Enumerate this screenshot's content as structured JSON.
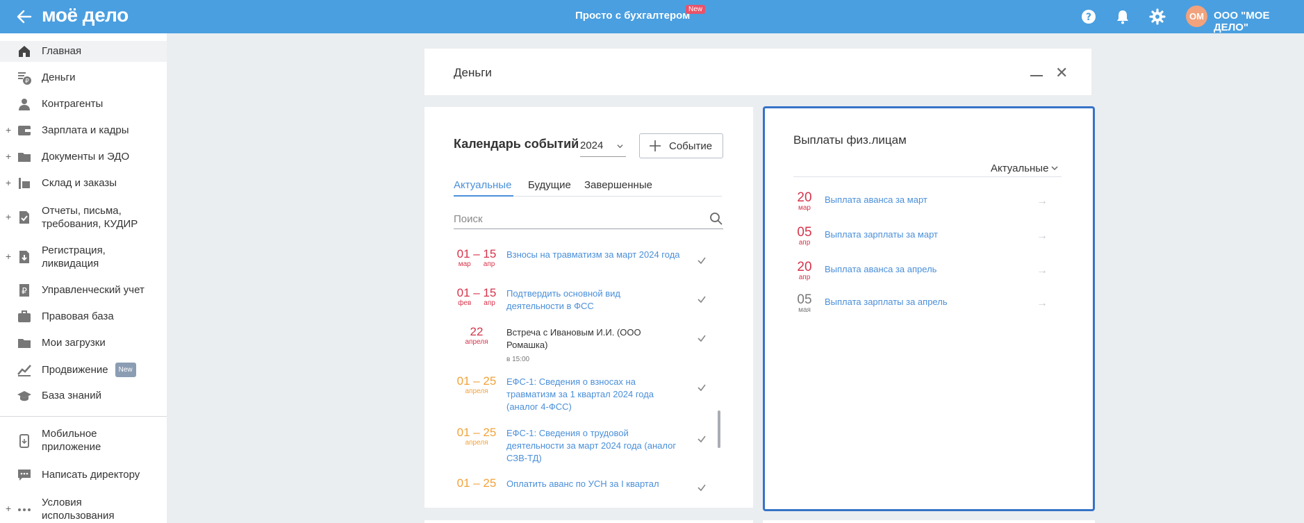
{
  "header": {
    "logo": "моё дело",
    "center_title": "Просто с бухгалтером",
    "center_badge": "New",
    "avatar_initials": "ОМ",
    "company": "ООО \"МОЕ ДЕЛО\""
  },
  "sidebar": {
    "items": [
      {
        "label": "Главная"
      },
      {
        "label": "Деньги"
      },
      {
        "label": "Контрагенты"
      },
      {
        "label": "Зарплата и кадры"
      },
      {
        "label": "Документы и ЭДО"
      },
      {
        "label": "Склад и заказы"
      },
      {
        "label": "Отчеты, письма, требования, КУДИР"
      },
      {
        "label": "Регистрация, ликвидация"
      },
      {
        "label": "Управленческий учет"
      },
      {
        "label": "Правовая база"
      },
      {
        "label": "Мои загрузки"
      },
      {
        "label": "Продвижение",
        "badge": "New"
      },
      {
        "label": "База знаний"
      }
    ],
    "bottom_items": [
      {
        "label": "Мобильное приложение"
      },
      {
        "label": "Написать директору"
      },
      {
        "label": "Условия использования"
      }
    ]
  },
  "money": {
    "title": "Деньги"
  },
  "calendar": {
    "title": "Календарь событий",
    "year": "2024",
    "add_event": "Событие",
    "tabs": [
      "Актуальные",
      "Будущие",
      "Завершенные"
    ],
    "search_placeholder": "Поиск",
    "events": [
      {
        "range": "01 – 15",
        "m1": "мар",
        "m2": "апр",
        "title": "Взносы на травматизм за март 2024 года",
        "sub": "",
        "color": "red"
      },
      {
        "range": "01 – 15",
        "m1": "фев",
        "m2": "апр",
        "title": "Подтвердить основной вид деятельности в ФСС",
        "sub": "",
        "color": "red"
      },
      {
        "range": "22",
        "m1": "апреля",
        "m2": "",
        "title": "Встреча с Ивановым И.И. (ООО Ромашка)",
        "sub": "в 15:00",
        "color": "red"
      },
      {
        "range": "01 – 25",
        "m1": "апреля",
        "m2": "",
        "title": "ЕФС-1: Сведения о взносах на травматизм за 1 квартал 2024 года (аналог 4-ФСС)",
        "sub": "",
        "color": "orange"
      },
      {
        "range": "01 – 25",
        "m1": "апреля",
        "m2": "",
        "title": "ЕФС-1: Сведения о трудовой деятельности за март 2024 года (аналог СЗВ-ТД)",
        "sub": "",
        "color": "orange"
      },
      {
        "range": "01 – 25",
        "m1": "",
        "m2": "",
        "title": "Оплатить аванс по УСН за I квартал",
        "sub": "",
        "color": "orange"
      }
    ]
  },
  "payments": {
    "title": "Выплаты физ.лицам",
    "filter": "Актуальные",
    "rows": [
      {
        "day": "20",
        "mon": "мар",
        "label": "Выплата аванса за март",
        "color": "red"
      },
      {
        "day": "05",
        "mon": "апр",
        "label": "Выплата зарплаты за март",
        "color": "red"
      },
      {
        "day": "20",
        "mon": "апр",
        "label": "Выплата аванса за апрель",
        "color": "red"
      },
      {
        "day": "05",
        "mon": "мая",
        "label": "Выплата зарплаты за апрель",
        "color": "gray"
      }
    ]
  },
  "colors": {
    "header_bg": "#4a9fe0",
    "link": "#4a8fd9",
    "overdue": "#d6334a",
    "upcoming": "#f2a23a",
    "highlight_border": "#3673c7"
  }
}
